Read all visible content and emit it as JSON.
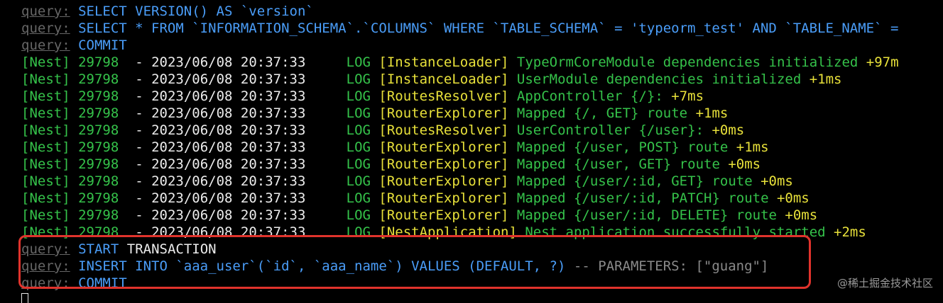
{
  "query_prefix": "query:",
  "lines_top": [
    {
      "sql": "SELECT VERSION() AS `version`"
    },
    {
      "sql": "SELECT * FROM `INFORMATION_SCHEMA`.`COLUMNS` WHERE `TABLE_SCHEMA` = 'typeorm_test' AND `TABLE_NAME` ="
    },
    {
      "sql": "COMMIT"
    }
  ],
  "nest": {
    "prefix": "[Nest]",
    "pid": "29798",
    "dash": "-",
    "timestamp": "2023/06/08 20:37:33",
    "level": "LOG",
    "entries": [
      {
        "context": "[InstanceLoader]",
        "message": "TypeOrmCoreModule dependencies initialized",
        "duration": "+97m"
      },
      {
        "context": "[InstanceLoader]",
        "message": "UserModule dependencies initialized",
        "duration": "+1ms"
      },
      {
        "context": "[RoutesResolver]",
        "message": "AppController {/}:",
        "duration": "+7ms"
      },
      {
        "context": "[RouterExplorer]",
        "message": "Mapped {/, GET} route",
        "duration": "+1ms"
      },
      {
        "context": "[RoutesResolver]",
        "message": "UserController {/user}:",
        "duration": "+0ms"
      },
      {
        "context": "[RouterExplorer]",
        "message": "Mapped {/user, POST} route",
        "duration": "+1ms"
      },
      {
        "context": "[RouterExplorer]",
        "message": "Mapped {/user, GET} route",
        "duration": "+0ms"
      },
      {
        "context": "[RouterExplorer]",
        "message": "Mapped {/user/:id, GET} route",
        "duration": "+0ms"
      },
      {
        "context": "[RouterExplorer]",
        "message": "Mapped {/user/:id, PATCH} route",
        "duration": "+0ms"
      },
      {
        "context": "[RouterExplorer]",
        "message": "Mapped {/user/:id, DELETE} route",
        "duration": "+0ms"
      },
      {
        "context": "[NestApplication]",
        "message": "Nest application successfully started",
        "duration": "+2ms"
      }
    ]
  },
  "transaction": {
    "start": "START TRANSACTION",
    "insert_sql": "INSERT INTO `aaa_user`(`id`, `aaa_name`) VALUES (DEFAULT, ?)",
    "insert_params": "-- PARAMETERS: [\"guang\"]",
    "commit": "COMMIT"
  },
  "watermark": "@稀土掘金技术社区",
  "colors": {
    "highlight_border": "#e0332c",
    "nest_green": "#35c24a",
    "context_yellow": "#e8e13a",
    "sql_blue": "#4a9df8"
  }
}
